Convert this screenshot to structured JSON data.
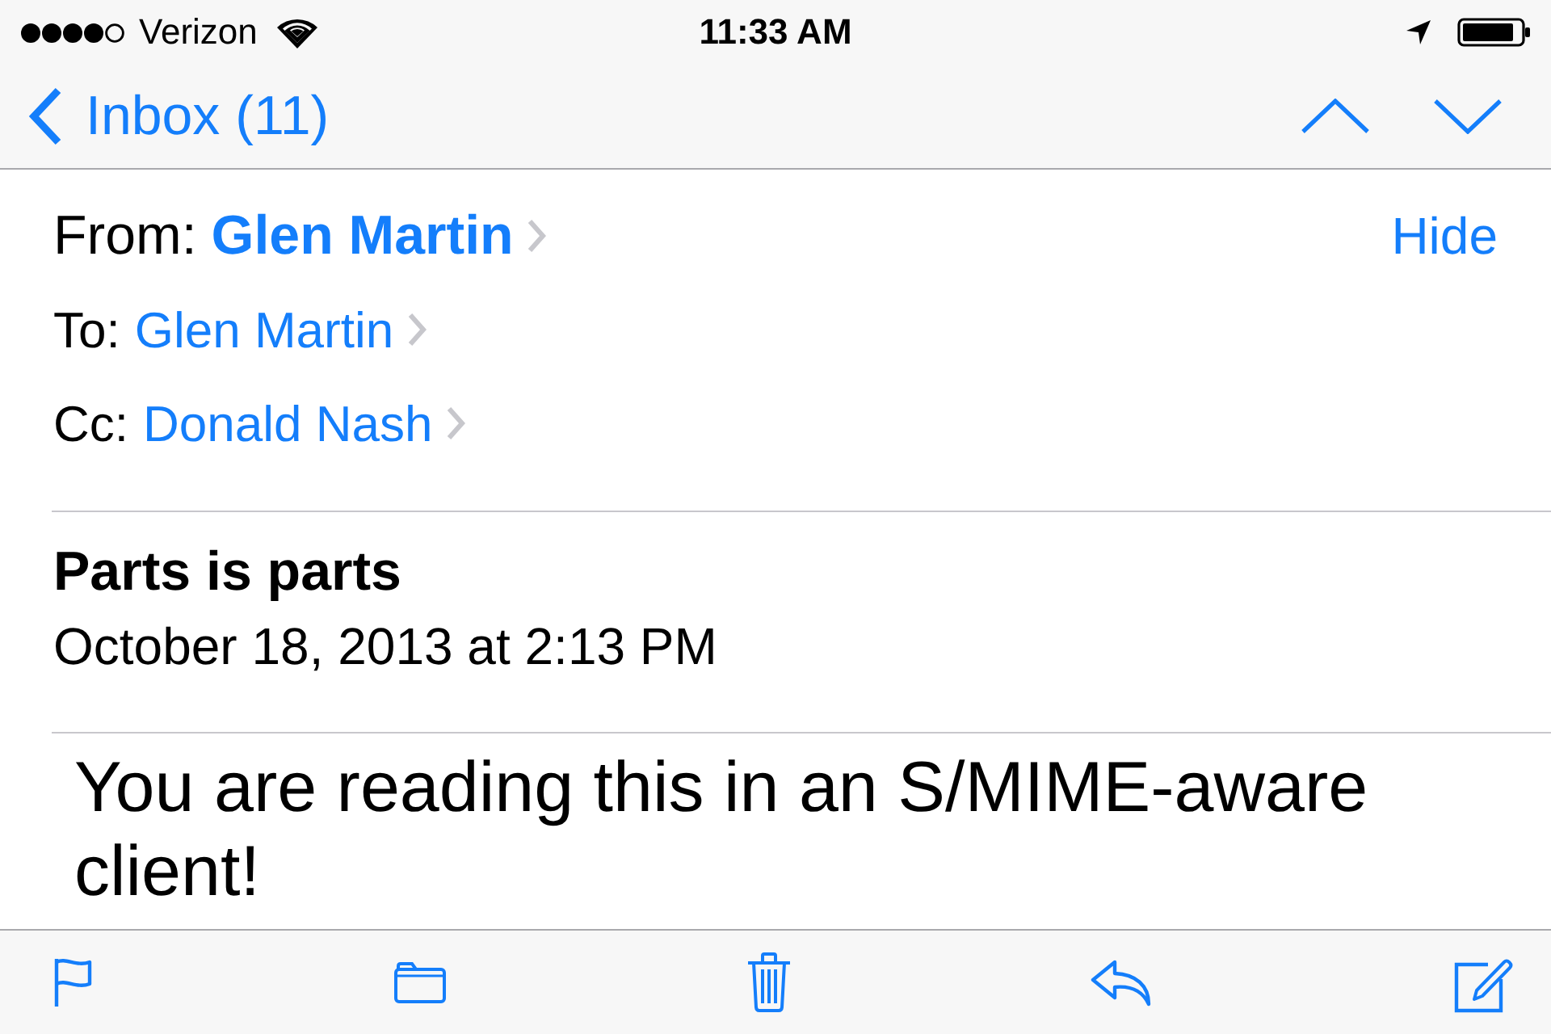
{
  "status_bar": {
    "carrier": "Verizon",
    "time": "11:33 AM"
  },
  "nav_bar": {
    "back_label": "Inbox (11)"
  },
  "header": {
    "fields": [
      {
        "kind": "sender",
        "label": "From:",
        "value": "Glen Martin"
      },
      {
        "kind": "recipient",
        "label": "To:",
        "value": "Glen Martin"
      },
      {
        "kind": "recipient",
        "label": "Cc:",
        "value": "Donald Nash"
      }
    ],
    "hide_label": "Hide"
  },
  "message": {
    "subject": "Parts is parts",
    "date": "October 18, 2013 at 2:13 PM",
    "body": "You are reading this in an S/MIME-aware client!"
  }
}
